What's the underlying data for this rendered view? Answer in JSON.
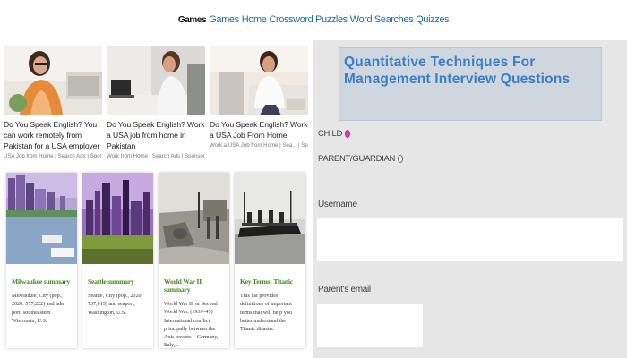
{
  "nav": {
    "brand": "Games",
    "links": [
      "Games",
      "Home",
      "Crossword Puzzles",
      "Word Searches",
      "Quizzes"
    ]
  },
  "ads": [
    {
      "title": "Do You Speak English? You can work remotely from Pakistan for a USA employer",
      "meta": "USA Job from Home | Search Ads | Sponsored"
    },
    {
      "title": "Do You Speak English? Work a USA job from home in Pakistan",
      "meta": "Work from Home | Search Ads | Sponsored"
    },
    {
      "title": "Do You Speak English? Work a USA Job From Home",
      "meta": "Work a USA Job from Home | Sea... | Sponsored"
    }
  ],
  "cards": [
    {
      "title": "Milwaukee summary",
      "desc": "Milwaukee, City (pop., 2020: 577,222) and lake port, southeast­ern Wisconsin, U.S."
    },
    {
      "title": "Seattle summary",
      "desc": "Seattle, City (pop., 2020: 737,015) and seaport, Washington, U.S."
    },
    {
      "title": "World War II summary",
      "desc": "World War II, or Second World War, (1939–45) International con­flict principally between the Axis powers—Germany, Italy,..."
    },
    {
      "title": "Key Terms: Titanic",
      "desc": "This list provides definitions of im­portant terms that will help you better understand the Titanic disaster."
    }
  ],
  "form": {
    "banner": "Quantitative Techniques For Management Interview Questions",
    "radio_child": "CHILD",
    "radio_parent": "PARENT/GUARDIAN",
    "username_label": "Username",
    "username_value": "",
    "parent_email_label": "Parent's email",
    "parent_email_value": ""
  },
  "colors": {
    "link": "#1d6fa5",
    "card_title": "#3e8a1d",
    "banner_text": "#3a7fc8",
    "panel_bg": "#e6e6e6"
  }
}
